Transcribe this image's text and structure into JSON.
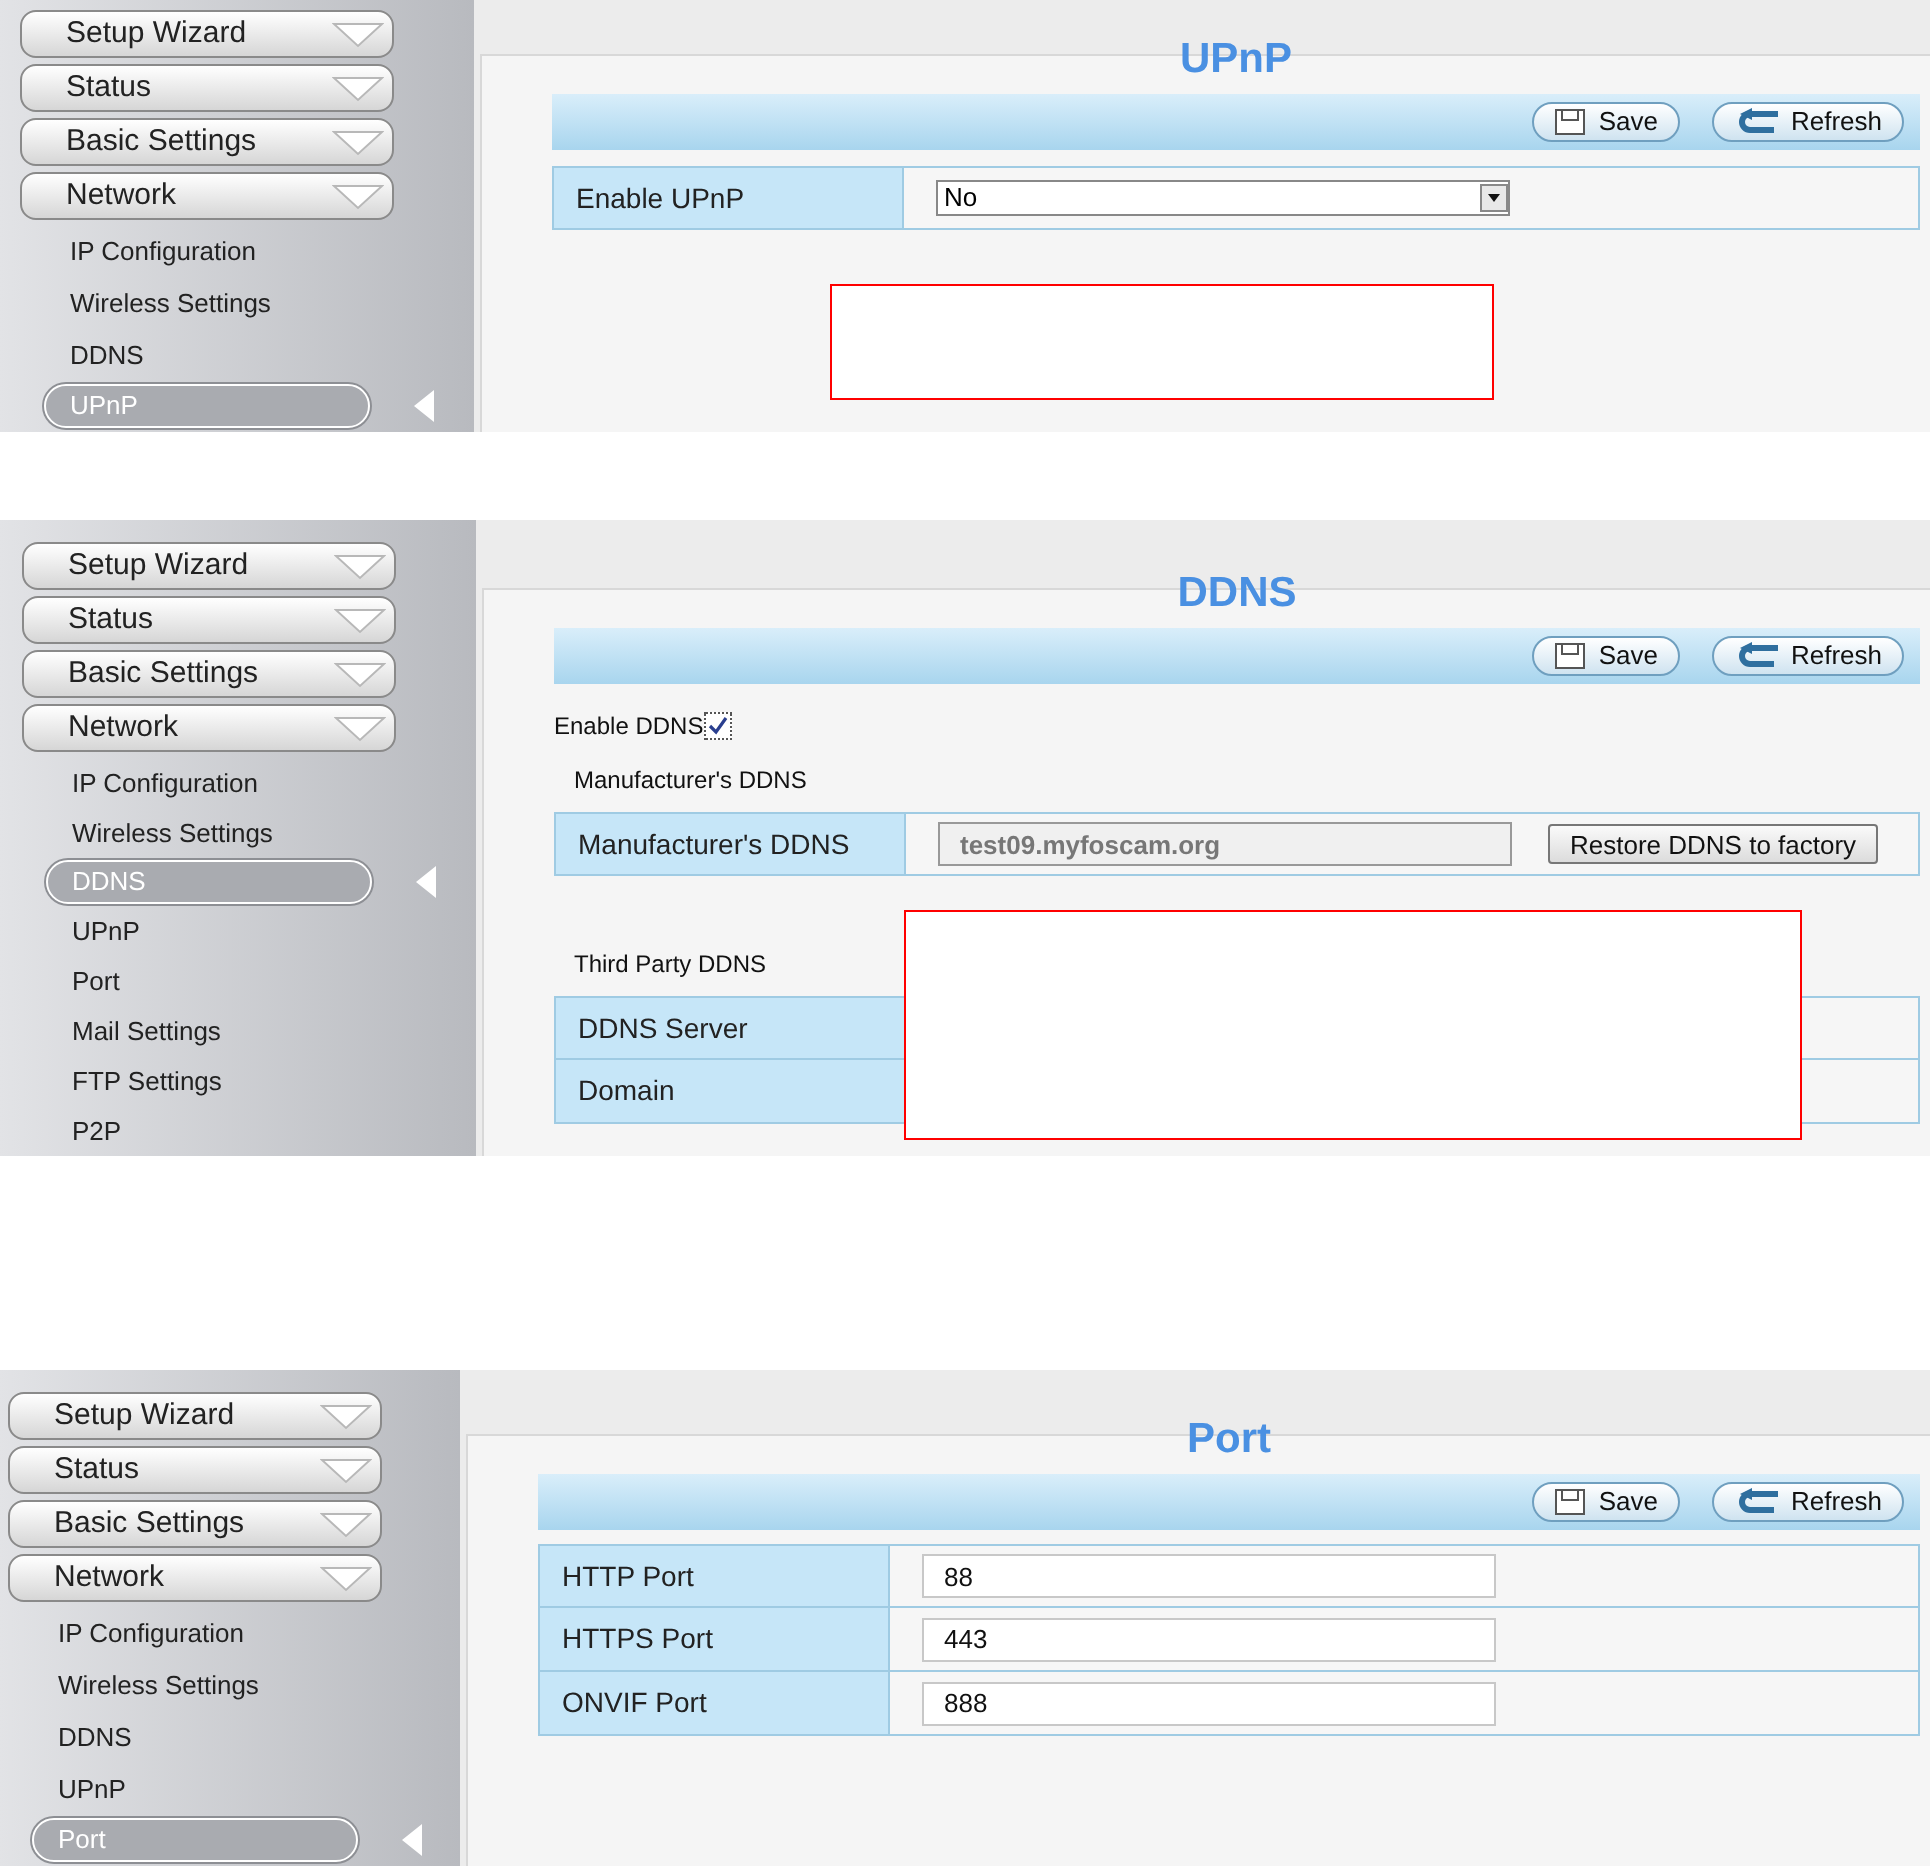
{
  "panels": [
    {
      "title": "UPnP",
      "highlight": true,
      "menu": [
        {
          "label": "Setup Wizard",
          "kind": "group",
          "selected": false
        },
        {
          "label": "Status",
          "kind": "group",
          "selected": false
        },
        {
          "label": "Basic Settings",
          "kind": "group",
          "selected": false
        },
        {
          "label": "Network",
          "kind": "group",
          "selected": false
        },
        {
          "label": "IP Configuration",
          "kind": "item",
          "selected": false
        },
        {
          "label": "Wireless Settings",
          "kind": "item",
          "selected": false
        },
        {
          "label": "DDNS",
          "kind": "item",
          "selected": false
        },
        {
          "label": "UPnP",
          "kind": "item",
          "selected": true
        }
      ],
      "buttons": [
        {
          "label": "Save",
          "kind": "save"
        },
        {
          "label": "Refresh",
          "kind": "refresh"
        }
      ],
      "content": [
        {
          "kind": "select_row",
          "label": "Enable UPnP",
          "value": "No"
        }
      ]
    },
    {
      "title": "DDNS",
      "highlight": true,
      "menu": [
        {
          "label": "Setup Wizard",
          "kind": "group",
          "selected": false
        },
        {
          "label": "Status",
          "kind": "group",
          "selected": false
        },
        {
          "label": "Basic Settings",
          "kind": "group",
          "selected": false
        },
        {
          "label": "Network",
          "kind": "group",
          "selected": false
        },
        {
          "label": "IP Configuration",
          "kind": "item",
          "selected": false
        },
        {
          "label": "Wireless Settings",
          "kind": "item",
          "selected": false
        },
        {
          "label": "DDNS",
          "kind": "item",
          "selected": true
        },
        {
          "label": "UPnP",
          "kind": "item",
          "selected": false
        },
        {
          "label": "Port",
          "kind": "item",
          "selected": false
        },
        {
          "label": "Mail Settings",
          "kind": "item",
          "selected": false
        },
        {
          "label": "FTP Settings",
          "kind": "item",
          "selected": false
        },
        {
          "label": "P2P",
          "kind": "item",
          "selected": false
        }
      ],
      "buttons": [
        {
          "label": "Save",
          "kind": "save"
        },
        {
          "label": "Refresh",
          "kind": "refresh"
        }
      ],
      "content": [
        {
          "kind": "checkbox",
          "label": "Enable DDNS",
          "checked": true
        },
        {
          "kind": "heading",
          "label": "Manufacturer's DDNS"
        },
        {
          "kind": "input_row",
          "label": "Manufacturer's DDNS",
          "value": "test09.myfoscam.org",
          "disabled": true,
          "button": "Restore DDNS to factory"
        },
        {
          "kind": "heading",
          "label": "Third Party DDNS"
        },
        {
          "kind": "row",
          "label": "DDNS Server"
        },
        {
          "kind": "row",
          "label": "Domain"
        }
      ]
    },
    {
      "title": "Port",
      "highlight": false,
      "menu": [
        {
          "label": "Setup Wizard",
          "kind": "group",
          "selected": false
        },
        {
          "label": "Status",
          "kind": "group",
          "selected": false
        },
        {
          "label": "Basic Settings",
          "kind": "group",
          "selected": false
        },
        {
          "label": "Network",
          "kind": "group",
          "selected": false
        },
        {
          "label": "IP Configuration",
          "kind": "item",
          "selected": false
        },
        {
          "label": "Wireless Settings",
          "kind": "item",
          "selected": false
        },
        {
          "label": "DDNS",
          "kind": "item",
          "selected": false
        },
        {
          "label": "UPnP",
          "kind": "item",
          "selected": false
        },
        {
          "label": "Port",
          "kind": "item",
          "selected": true
        }
      ],
      "buttons": [
        {
          "label": "Save",
          "kind": "save"
        },
        {
          "label": "Refresh",
          "kind": "refresh"
        }
      ],
      "content": [
        {
          "kind": "input_row",
          "label": "HTTP Port",
          "value": "88",
          "disabled": false
        },
        {
          "kind": "input_row",
          "label": "HTTPS Port",
          "value": "443",
          "disabled": false
        },
        {
          "kind": "input_row",
          "label": "ONVIF Port",
          "value": "888",
          "disabled": false
        }
      ]
    }
  ]
}
